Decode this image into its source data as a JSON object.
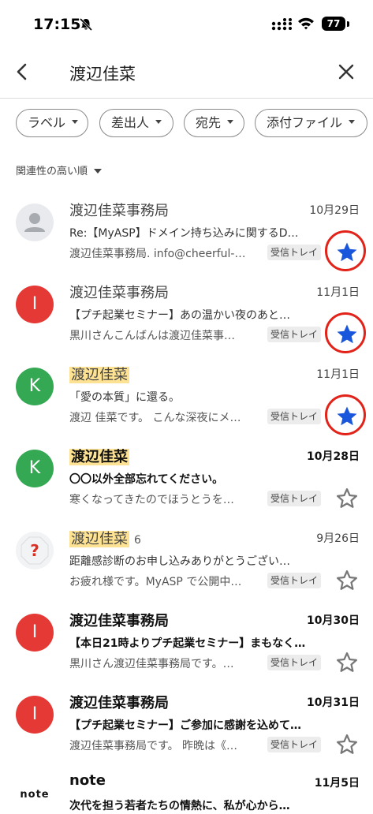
{
  "status_bar": {
    "time": "17:15",
    "battery": "77"
  },
  "search": {
    "query": "渡辺佳菜"
  },
  "filters": [
    {
      "label": "ラベル"
    },
    {
      "label": "差出人"
    },
    {
      "label": "宛先"
    },
    {
      "label": "添付ファイル"
    }
  ],
  "sort_label": "関連性の高い順",
  "mails": [
    {
      "sender": "渡辺佳菜事務局",
      "count": "",
      "date": "10月29日",
      "subject": "Re:【MyASP】ドメイン持ち込みに関するD…",
      "snippet": "渡辺佳菜事務局. info@cheerful-…",
      "label": "受信トレイ",
      "starred": true,
      "unread": false,
      "avatar": {
        "type": "person",
        "letter": "",
        "color": "#e8eaed"
      }
    },
    {
      "sender": "渡辺佳菜事務局",
      "count": "",
      "date": "11月1日",
      "subject": "【プチ起業セミナー】あの温かい夜のあと…",
      "snippet": "黒川さんこんばんは渡辺佳菜事…",
      "label": "受信トレイ",
      "starred": true,
      "unread": false,
      "avatar": {
        "type": "letter",
        "letter": "I",
        "color": "#e53935"
      }
    },
    {
      "sender": "渡辺佳菜",
      "count": "",
      "date": "11月1日",
      "subject": "「愛の本質」に還る。",
      "snippet": "渡辺 佳菜です。 こんな深夜にメ…",
      "label": "受信トレイ",
      "starred": true,
      "unread": false,
      "avatar": {
        "type": "letter",
        "letter": "K",
        "color": "#34a853"
      }
    },
    {
      "sender": "渡辺佳菜",
      "count": "",
      "date": "10月28日",
      "subject": "〇〇以外全部忘れてください。",
      "snippet": "寒くなってきたのでほうとうを…",
      "label": "受信トレイ",
      "starred": false,
      "unread": true,
      "avatar": {
        "type": "letter",
        "letter": "K",
        "color": "#34a853"
      }
    },
    {
      "sender": "渡辺佳菜",
      "count": "6",
      "date": "9月26日",
      "subject": "距離感診断のお申し込みありがとうござい…",
      "snippet": "お疲れ様です。MyASP で公開中…",
      "label": "受信トレイ",
      "starred": false,
      "unread": false,
      "avatar": {
        "type": "unknown",
        "letter": "?",
        "color": "#f1f3f4"
      }
    },
    {
      "sender": "渡辺佳菜事務局",
      "count": "",
      "date": "10月30日",
      "subject": "【本日21時よりプチ起業セミナー】まもなく…",
      "snippet": "黒川さん渡辺佳菜事務局です。…",
      "label": "受信トレイ",
      "starred": false,
      "unread": true,
      "avatar": {
        "type": "letter",
        "letter": "I",
        "color": "#e53935"
      }
    },
    {
      "sender": "渡辺佳菜事務局",
      "count": "",
      "date": "10月31日",
      "subject": "【プチ起業セミナー】ご参加に感謝を込めて…",
      "snippet": "渡辺佳菜事務局です。 昨晩は《…",
      "label": "受信トレイ",
      "starred": false,
      "unread": true,
      "avatar": {
        "type": "letter",
        "letter": "I",
        "color": "#e53935"
      }
    },
    {
      "sender": "note",
      "count": "",
      "date": "11月5日",
      "subject": "次代を担う若者たちの情熱に、私が心から…",
      "snippet": "",
      "label": "",
      "starred": false,
      "unread": true,
      "avatar": {
        "type": "logo",
        "letter": "note",
        "color": "#ffffff"
      }
    }
  ]
}
